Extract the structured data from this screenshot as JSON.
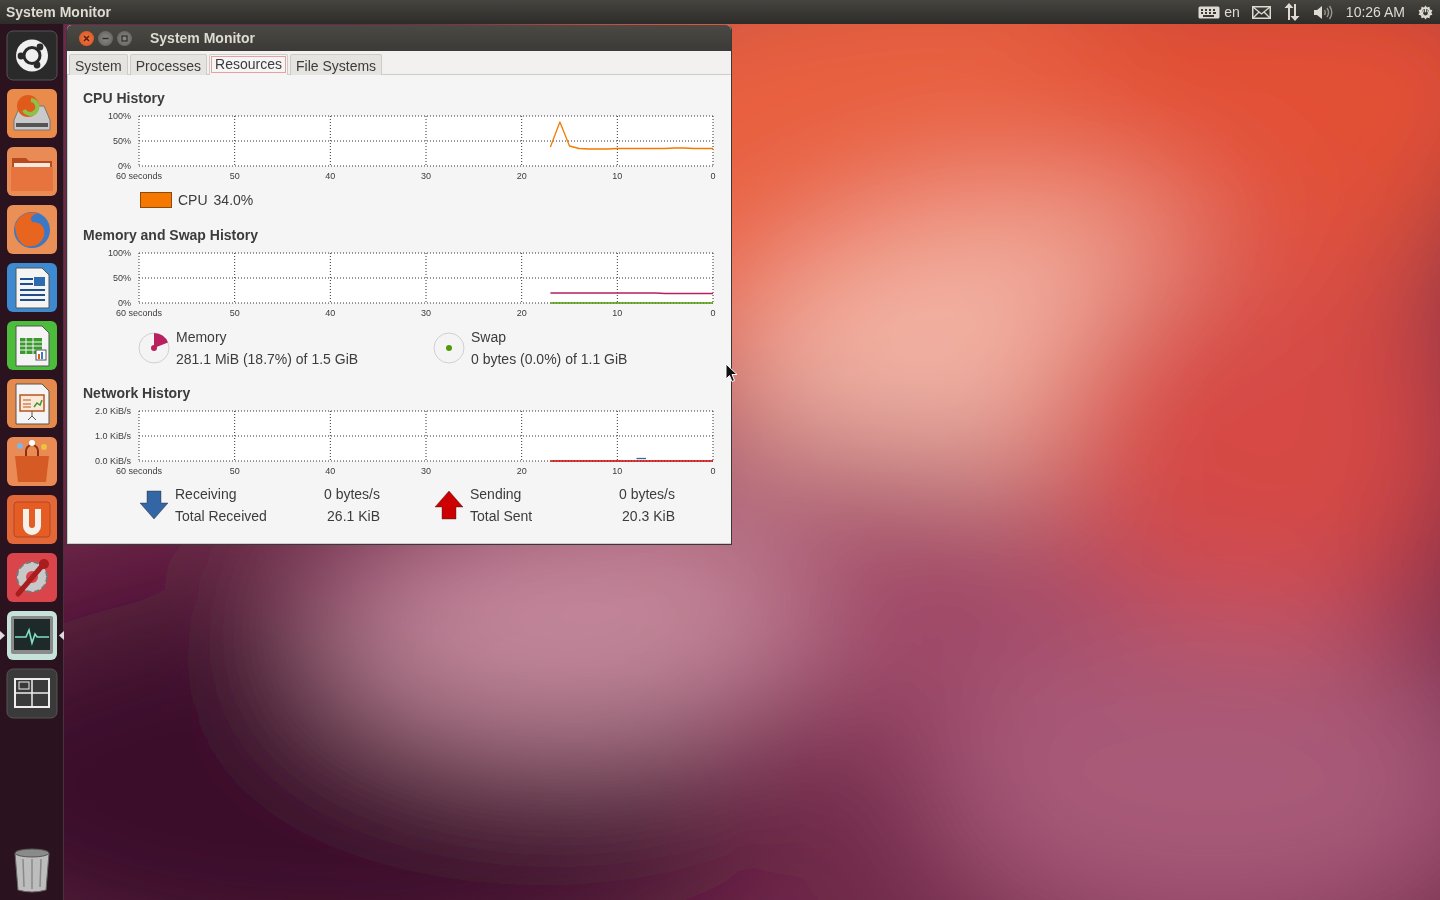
{
  "top_panel": {
    "app_name": "System Monitor",
    "keyboard_layout": "en",
    "clock": "10:26 AM"
  },
  "launcher": {
    "items": [
      {
        "kind": "ubuntu",
        "active": false
      },
      {
        "kind": "installer",
        "active": false
      },
      {
        "kind": "folder",
        "active": false
      },
      {
        "kind": "browser",
        "active": false
      },
      {
        "kind": "writer",
        "active": false
      },
      {
        "kind": "calc",
        "active": false
      },
      {
        "kind": "impress",
        "active": false
      },
      {
        "kind": "store",
        "active": false
      },
      {
        "kind": "ubuntu-one",
        "active": false
      },
      {
        "kind": "settings",
        "active": false
      },
      {
        "kind": "monitor",
        "active": true
      },
      {
        "kind": "workspaces",
        "active": false
      },
      {
        "kind": "trash",
        "active": false
      }
    ]
  },
  "window": {
    "title": "System Monitor",
    "tabs": [
      {
        "label": "System",
        "selected": false
      },
      {
        "label": "Processes",
        "selected": false
      },
      {
        "label": "Resources",
        "selected": true
      },
      {
        "label": "File Systems",
        "selected": false
      }
    ],
    "cpu": {
      "heading": "CPU History",
      "chart_data": {
        "type": "line",
        "grid": true,
        "xlim": [
          60,
          0
        ],
        "ylim": [
          0,
          100
        ],
        "xticks": [
          {
            "value": 60,
            "label": "60 seconds"
          },
          50,
          40,
          30,
          20,
          10,
          0
        ],
        "yticks": [
          {
            "value": 0,
            "label": "0%"
          },
          {
            "value": 50,
            "label": "50%"
          },
          {
            "value": 100,
            "label": "100%"
          }
        ],
        "x": [
          17,
          16,
          15,
          14,
          13,
          12,
          11,
          10,
          9,
          8,
          7,
          6,
          5,
          4,
          3,
          2,
          1,
          0
        ],
        "series": [
          {
            "name": "CPU",
            "color": "#f57900",
            "values": [
              38,
              88,
              40,
              35,
              34,
              34,
              34,
              35,
              35,
              35,
              35,
              35,
              35,
              36,
              36,
              35,
              35,
              35
            ]
          }
        ]
      },
      "legend": [
        {
          "value": "34.0%"
        }
      ]
    },
    "memory": {
      "heading": "Memory and Swap History",
      "chart_data": {
        "type": "line",
        "grid": true,
        "xlim": [
          60,
          0
        ],
        "ylim": [
          0,
          100
        ],
        "xticks": [
          {
            "value": 60,
            "label": "60 seconds"
          },
          50,
          40,
          30,
          20,
          10,
          0
        ],
        "yticks": [
          {
            "value": 0,
            "label": "0%"
          },
          {
            "value": 50,
            "label": "50%"
          },
          {
            "value": 100,
            "label": "100%"
          }
        ],
        "x": [
          17,
          16,
          15,
          14,
          13,
          12,
          11,
          10,
          9,
          8,
          7,
          6,
          5,
          4,
          3,
          2,
          1,
          0
        ],
        "series": [
          {
            "name": "Memory",
            "color": "#b8205f",
            "values": [
              20,
              20,
              20,
              20,
              20,
              20,
              20,
              20,
              20,
              20,
              20,
              20,
              19,
              19,
              19,
              19,
              19,
              19
            ]
          },
          {
            "name": "Swap",
            "color": "#4e9a06",
            "values": [
              0,
              0,
              0,
              0,
              0,
              0,
              0,
              0,
              0,
              0,
              0,
              0,
              0,
              0,
              0,
              0,
              0,
              0
            ]
          }
        ]
      },
      "items": [
        {
          "value": "281.1 MiB (18.7%) of 1.5 GiB"
        },
        {
          "value": "0 bytes (0.0%) of 1.1 GiB"
        }
      ]
    },
    "network": {
      "heading": "Network History",
      "chart_data": {
        "type": "line",
        "grid": true,
        "xlim": [
          60,
          0
        ],
        "ylim": [
          0,
          2
        ],
        "xticks": [
          {
            "value": 60,
            "label": "60 seconds"
          },
          50,
          40,
          30,
          20,
          10,
          0
        ],
        "yticks": [
          {
            "value": 0,
            "label": "0.0 KiB/s"
          },
          {
            "value": 1,
            "label": "1.0 KiB/s"
          },
          {
            "value": 2,
            "label": "2.0 KiB/s"
          }
        ],
        "x": [
          17,
          16,
          15,
          14,
          13,
          12,
          11,
          10,
          9,
          8,
          7,
          6,
          5,
          4,
          3,
          2,
          1,
          0
        ],
        "series": [
          {
            "name": "Receiving",
            "color": "#3465a4",
            "values": [
              null,
              null,
              null,
              null,
              null,
              null,
              null,
              null,
              null,
              0.1,
              0.1,
              null,
              null,
              null,
              null,
              null,
              null,
              null
            ]
          },
          {
            "name": "Sending",
            "color": "#cc0000",
            "values": [
              0,
              0,
              0,
              0,
              0,
              0,
              0,
              0,
              0,
              0,
              0,
              0,
              0,
              0,
              0,
              0,
              0,
              0
            ]
          }
        ]
      },
      "items": [
        {
          "kind": "receive",
          "rate": "0 bytes/s",
          "total_label": "Total Received",
          "total": "26.1 KiB"
        },
        {
          "kind": "send",
          "rate": "0 bytes/s",
          "total_label": "Total Sent",
          "total": "20.3 KiB"
        }
      ]
    }
  }
}
